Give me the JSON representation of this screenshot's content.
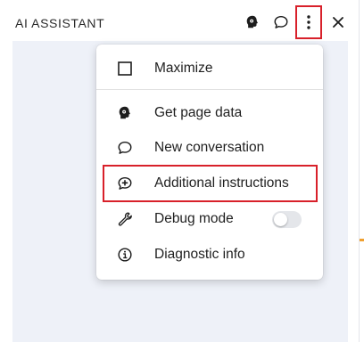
{
  "panel": {
    "title": "AI ASSISTANT"
  },
  "header_icons": [
    "bot-icon",
    "chat-bubble-icon",
    "more-vertical-icon",
    "close-icon"
  ],
  "menu": {
    "items": [
      {
        "label": "Maximize",
        "icon": "square-icon"
      },
      {
        "label": "Get page data",
        "icon": "bot-head-icon"
      },
      {
        "label": "New conversation",
        "icon": "chat-bubble-icon"
      },
      {
        "label": "Additional instructions",
        "icon": "chat-plus-icon"
      },
      {
        "label": "Debug mode",
        "icon": "wrench-icon",
        "toggle": false
      },
      {
        "label": "Diagnostic info",
        "icon": "info-circle-icon"
      }
    ]
  },
  "colors": {
    "highlight": "#d8202a",
    "content_bg": "#eef1f8",
    "accent": "#f0a030"
  }
}
